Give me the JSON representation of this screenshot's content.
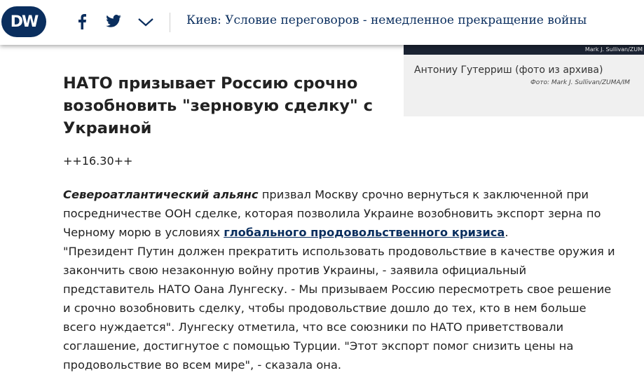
{
  "header": {
    "logo_text": "DW",
    "share_icons": [
      "facebook-icon",
      "twitter-icon",
      "chevron-down-icon"
    ],
    "headline": "Киев: Условие переговоров - немедленное прекращение войны"
  },
  "image_card": {
    "overlay_credit": "Mark J. Sullivan/ZUM",
    "caption": "Антониу Гутерриш (фото из архива)",
    "photo_credit": "Фото: Mark J. Sullivan/ZUMA/IM"
  },
  "article": {
    "title": "НАТО призывает Россию срочно возобновить \"зерновую сделку\" с Украиной",
    "time": "++16.30++",
    "lead": "Североатлантический альянс",
    "p1": " призвал Москву срочно вернуться к заключенной при посредничестве ООН сделке, которая позволила Украине возобновить экспорт зерна по Черному морю в условиях ",
    "link": "глобального продовольственного кризиса",
    "p1_end": ".",
    "p2": "\"Президент Путин должен прекратить использовать продовольствие в качестве оружия и закончить свою незаконную войну против Украины, - заявила официальный представитель НАТО Оана Лунгеску. - Мы призываем Россию пересмотреть свое решение и срочно возобновить сделку, чтобы продовольствие дошло до тех, кто в нем больше всего нуждается\". Лунгеску отметила, что все союзники по НАТО приветствовали соглашение, достигнутое с помощью Турции. \"Этот экспорт помог снизить цены на продовольствие во всем мире\", - сказала она."
  },
  "colors": {
    "brand": "#0a2e5e"
  }
}
